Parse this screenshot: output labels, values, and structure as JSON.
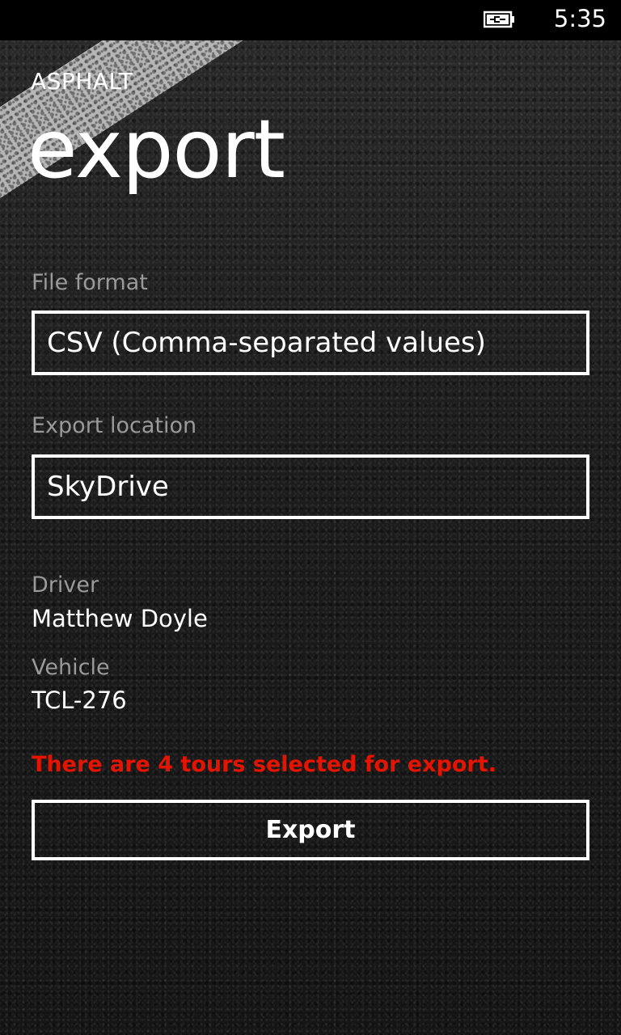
{
  "status_bar": {
    "time": "5:35",
    "battery_icon": "battery-charging-icon"
  },
  "header": {
    "app_title": "ASPHALT",
    "page_title": "export"
  },
  "form": {
    "file_format": {
      "label": "File format",
      "value": "CSV (Comma-separated values)"
    },
    "export_location": {
      "label": "Export location",
      "value": "SkyDrive"
    }
  },
  "info": {
    "driver_label": "Driver",
    "driver_value": "Matthew Doyle",
    "vehicle_label": "Vehicle",
    "vehicle_value": "TCL-276"
  },
  "warning_text": "There are 4 tours selected for export.",
  "export_button_label": "Export",
  "colors": {
    "accent": "#e51400",
    "label": "#9a9a9a",
    "foreground": "#ffffff"
  }
}
